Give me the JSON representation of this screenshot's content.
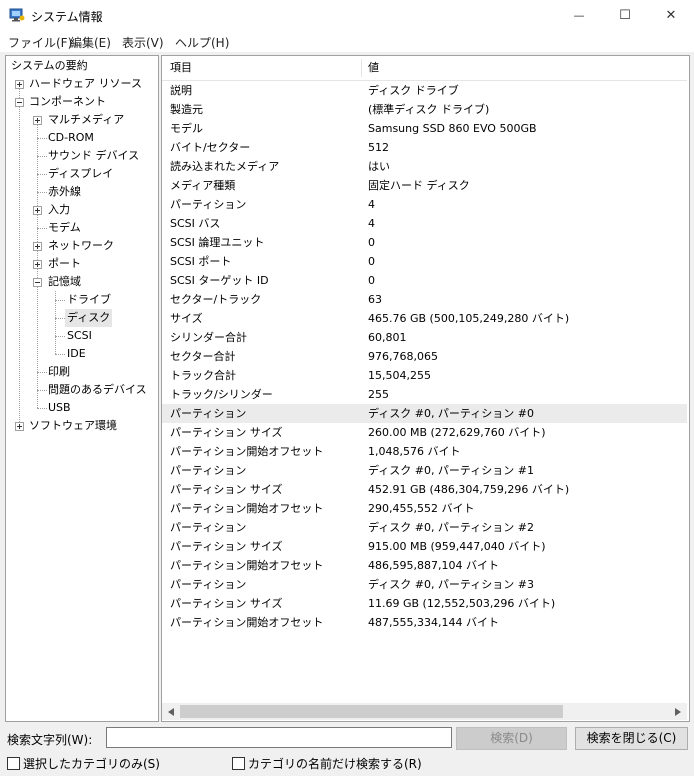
{
  "window": {
    "title": "システム情報",
    "minimize_glyph": "—",
    "maximize_glyph": "☐",
    "close_glyph": "✕"
  },
  "menu": [
    {
      "label": "ファイル(F)"
    },
    {
      "label": "編集(E)"
    },
    {
      "label": "表示(V)"
    },
    {
      "label": "ヘルプ(H)"
    }
  ],
  "tree": {
    "items": [
      {
        "label": "システムの要約"
      },
      {
        "label": "ハードウェア リソース"
      },
      {
        "label": "コンポーネント"
      },
      {
        "label": "マルチメディア"
      },
      {
        "label": "CD-ROM"
      },
      {
        "label": "サウンド デバイス"
      },
      {
        "label": "ディスプレイ"
      },
      {
        "label": "赤外線"
      },
      {
        "label": "入力"
      },
      {
        "label": "モデム"
      },
      {
        "label": "ネットワーク"
      },
      {
        "label": "ポート"
      },
      {
        "label": "記憶域"
      },
      {
        "label": "ドライブ"
      },
      {
        "label": "ディスク"
      },
      {
        "label": "SCSI"
      },
      {
        "label": "IDE"
      },
      {
        "label": "印刷"
      },
      {
        "label": "問題のあるデバイス"
      },
      {
        "label": "USB"
      },
      {
        "label": "ソフトウェア環境"
      }
    ]
  },
  "table": {
    "columns": [
      "項目",
      "値"
    ],
    "rows": [
      [
        "説明",
        "ディスク ドライブ"
      ],
      [
        "製造元",
        "(標準ディスク ドライブ)"
      ],
      [
        "モデル",
        "Samsung SSD 860 EVO 500GB"
      ],
      [
        "バイト/セクター",
        "512"
      ],
      [
        "読み込まれたメディア",
        "はい"
      ],
      [
        "メディア種類",
        "固定ハード ディスク"
      ],
      [
        "パーティション",
        "4"
      ],
      [
        "SCSI バス",
        "4"
      ],
      [
        "SCSI 論理ユニット",
        "0"
      ],
      [
        "SCSI ポート",
        "0"
      ],
      [
        "SCSI ターゲット ID",
        "0"
      ],
      [
        "セクター/トラック",
        "63"
      ],
      [
        "サイズ",
        "465.76 GB (500,105,249,280 バイト)"
      ],
      [
        "シリンダー合計",
        "60,801"
      ],
      [
        "セクター合計",
        "976,768,065"
      ],
      [
        "トラック合計",
        "15,504,255"
      ],
      [
        "トラック/シリンダー",
        "255"
      ],
      [
        "パーティション",
        "ディスク #0, パーティション #0"
      ],
      [
        "パーティション サイズ",
        "260.00 MB (272,629,760 バイト)"
      ],
      [
        "パーティション開始オフセット",
        "1,048,576 バイト"
      ],
      [
        "パーティション",
        "ディスク #0, パーティション #1"
      ],
      [
        "パーティション サイズ",
        "452.91 GB (486,304,759,296 バイト)"
      ],
      [
        "パーティション開始オフセット",
        "290,455,552 バイト"
      ],
      [
        "パーティション",
        "ディスク #0, パーティション #2"
      ],
      [
        "パーティション サイズ",
        "915.00 MB (959,447,040 バイト)"
      ],
      [
        "パーティション開始オフセット",
        "486,595,887,104 バイト"
      ],
      [
        "パーティション",
        "ディスク #0, パーティション #3"
      ],
      [
        "パーティション サイズ",
        "11.69 GB (12,552,503,296 バイト)"
      ],
      [
        "パーティション開始オフセット",
        "487,555,334,144 バイト"
      ]
    ]
  },
  "search": {
    "label": "検索文字列(W):",
    "value": "",
    "search_button": "検索(D)",
    "close_button": "検索を閉じる(C)",
    "only_selected": "選択したカテゴリのみ(S)",
    "names_only": "カテゴリの名前だけ検索する(R)"
  },
  "colors": {
    "title_bg": "#ffffff",
    "window_bg": "#f0f0f0",
    "selected_tree_bg": "#e6e6e6",
    "highlight_row_bg": "#ebebeb",
    "disabled_text": "#8a8a8a"
  }
}
